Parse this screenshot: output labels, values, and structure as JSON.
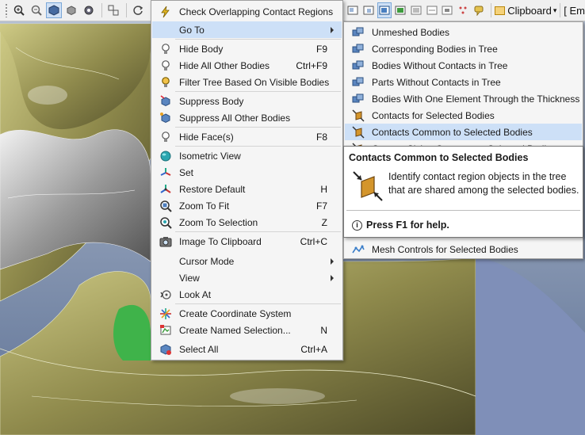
{
  "toolbar_right": {
    "clipboard_label": "Clipboard",
    "dropdown_arrow": "▾",
    "next_label": "[ Em"
  },
  "context_menu": {
    "items": [
      {
        "label": "Check Overlapping Contact Regions",
        "shortcut": "",
        "icon": "lightning-icon"
      },
      {
        "label": "Go To",
        "shortcut": "",
        "icon": "",
        "submenu": true,
        "highlighted": true
      },
      {
        "label": "Hide Body",
        "shortcut": "F9",
        "icon": "bulb-icon"
      },
      {
        "label": "Hide All Other Bodies",
        "shortcut": "Ctrl+F9",
        "icon": "bulb-icon"
      },
      {
        "label": "Filter Tree Based On Visible Bodies",
        "shortcut": "",
        "icon": "bulb-filter-icon"
      },
      {
        "label": "Suppress Body",
        "shortcut": "",
        "icon": "suppress-body-icon"
      },
      {
        "label": "Suppress All Other Bodies",
        "shortcut": "",
        "icon": "suppress-others-icon"
      },
      {
        "label": "Hide Face(s)",
        "shortcut": "F8",
        "icon": "bulb-icon"
      },
      {
        "label": "Isometric View",
        "shortcut": "",
        "icon": "isometric-icon"
      },
      {
        "label": "Set",
        "shortcut": "",
        "icon": "axis-set-icon"
      },
      {
        "label": "Restore Default",
        "shortcut": "H",
        "icon": "axis-restore-icon"
      },
      {
        "label": "Zoom To Fit",
        "shortcut": "F7",
        "icon": "zoom-fit-icon"
      },
      {
        "label": "Zoom To Selection",
        "shortcut": "Z",
        "icon": "zoom-selection-icon"
      },
      {
        "label": "Image To Clipboard",
        "shortcut": "Ctrl+C",
        "icon": "camera-icon"
      },
      {
        "label": "Cursor Mode",
        "shortcut": "",
        "icon": "",
        "submenu": true
      },
      {
        "label": "View",
        "shortcut": "",
        "icon": "",
        "submenu": true
      },
      {
        "label": "Look At",
        "shortcut": "",
        "icon": "look-at-icon"
      },
      {
        "label": "Create Coordinate System",
        "shortcut": "",
        "icon": "coordinate-system-icon"
      },
      {
        "label": "Create Named Selection...",
        "shortcut": "N",
        "icon": "named-selection-icon"
      },
      {
        "label": "Select All",
        "shortcut": "Ctrl+A",
        "icon": "select-all-icon"
      }
    ]
  },
  "submenu": {
    "items": [
      {
        "label": "Unmeshed Bodies",
        "icon": "bodies-icon"
      },
      {
        "label": "Corresponding Bodies in Tree",
        "icon": "bodies-icon"
      },
      {
        "label": "Bodies Without Contacts in Tree",
        "icon": "bodies-icon"
      },
      {
        "label": "Parts Without Contacts in Tree",
        "icon": "bodies-icon"
      },
      {
        "label": "Bodies With One Element Through the Thickness",
        "icon": "bodies-icon"
      },
      {
        "label": "Contacts for Selected Bodies",
        "icon": "contact-icon"
      },
      {
        "label": "Contacts Common to Selected Bodies",
        "icon": "contact-icon",
        "highlighted": true
      },
      {
        "label": "Contact Sizing Common to Selected Bodies",
        "icon": "contact-icon"
      },
      {
        "label": "Mesh Controls for Selected Bodies",
        "icon": "mesh-controls-icon"
      }
    ]
  },
  "tooltip": {
    "title": "Contacts Common to Selected Bodies",
    "description": "Identify contact region objects in the tree that are shared among the selected bodies.",
    "help": "Press F1 for help.",
    "info_glyph": "i"
  },
  "colors": {
    "highlight": "#cde0f7",
    "model_olive": "#8f8a4c",
    "background_blue": "#7f8fa8"
  }
}
